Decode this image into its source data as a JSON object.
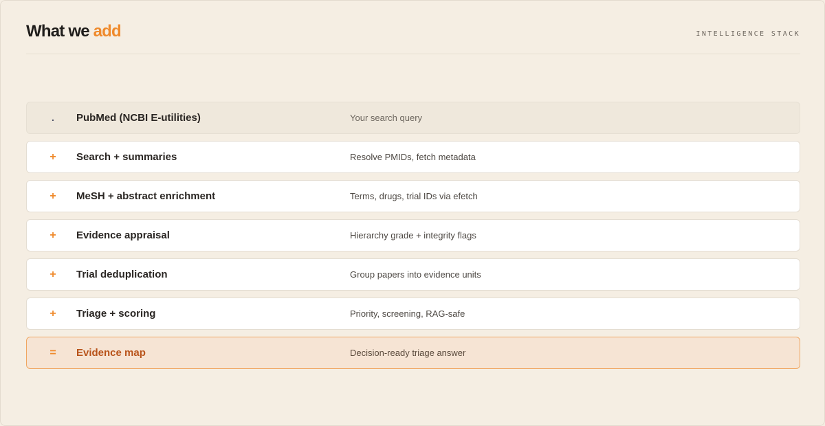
{
  "header": {
    "title_main": "What we ",
    "title_accent": "add",
    "stack_label": "INTELLIGENCE STACK"
  },
  "colors": {
    "accent": "#ef8a2c",
    "background": "#f5eee3",
    "result_background": "#f6e4d4",
    "result_text": "#b8531a"
  },
  "rows": [
    {
      "marker": ".",
      "name": "PubMed (NCBI E-utilities)",
      "description": "Your search query",
      "kind": "source"
    },
    {
      "marker": "+",
      "name": "Search + summaries",
      "description": "Resolve PMIDs, fetch metadata",
      "kind": "step"
    },
    {
      "marker": "+",
      "name": "MeSH + abstract enrichment",
      "description": "Terms, drugs, trial IDs via efetch",
      "kind": "step"
    },
    {
      "marker": "+",
      "name": "Evidence appraisal",
      "description": "Hierarchy grade + integrity flags",
      "kind": "step"
    },
    {
      "marker": "+",
      "name": "Trial deduplication",
      "description": "Group papers into evidence units",
      "kind": "step"
    },
    {
      "marker": "+",
      "name": "Triage + scoring",
      "description": "Priority, screening, RAG-safe",
      "kind": "step"
    },
    {
      "marker": "=",
      "name": "Evidence map",
      "description": "Decision-ready triage answer",
      "kind": "result"
    }
  ]
}
